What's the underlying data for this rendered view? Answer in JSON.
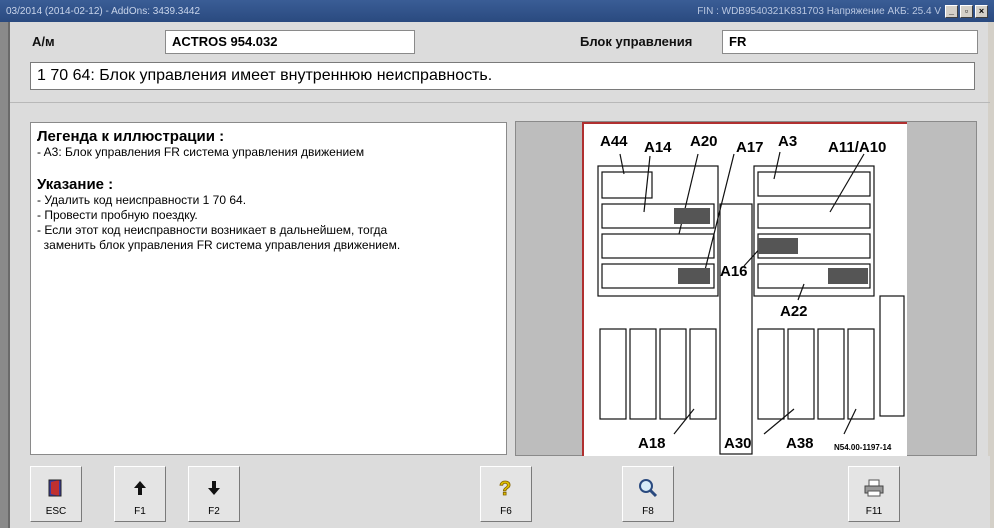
{
  "window": {
    "title": "03/2014 (2014-02-12) - AddOns: 3439.3442",
    "status_right": "FIN : WDB9540321K831703    Напряжение АКБ: 25.4 V"
  },
  "header": {
    "vehicle_label": "А/м",
    "vehicle_value": "ACTROS 954.032",
    "ecu_label": "Блок управления",
    "ecu_value": "FR"
  },
  "message": "1 70 64: Блок управления имеет внутреннюю неисправность.",
  "legend": {
    "title": "Легенда к иллюстрации :",
    "lines": [
      "- A3: Блок управления FR система управления движением"
    ]
  },
  "note": {
    "title": "Указание :",
    "lines": [
      "- Удалить код неисправности 1 70 64.",
      "- Провести пробную поездку.",
      "- Если этот код неисправности возникает в дальнейшем, тогда",
      "  заменить блок управления FR система управления движением."
    ]
  },
  "diagram": {
    "labels": [
      "A44",
      "A14",
      "A20",
      "A17",
      "A3",
      "A11/A10",
      "A16",
      "A22",
      "A18",
      "A30",
      "A38"
    ],
    "ref": "N54.00-1197-14"
  },
  "fkeys": [
    {
      "label": "ESC",
      "icon": "exit-door-icon"
    },
    {
      "label": "F1",
      "icon": "arrow-up-icon"
    },
    {
      "label": "F2",
      "icon": "arrow-down-icon"
    },
    {
      "label": "F6",
      "icon": "help-question-icon"
    },
    {
      "label": "F8",
      "icon": "magnifier-icon"
    },
    {
      "label": "F11",
      "icon": "printer-icon"
    }
  ],
  "colors": {
    "titlebar": "#2a4a7f",
    "accent_border": "#b03030",
    "background": "#dcdcdc"
  }
}
